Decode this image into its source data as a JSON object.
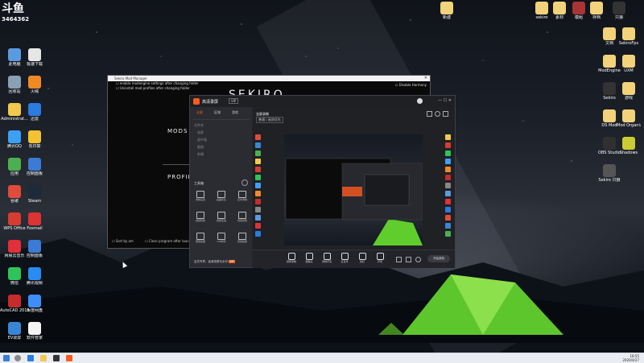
{
  "desktop": {
    "live_badge_number": "3464362",
    "icons_left": [
      {
        "label": "此电脑",
        "color": "#5a9be0"
      },
      {
        "label": "回收站",
        "color": "#8aa0b5"
      },
      {
        "label": "Administrat...",
        "color": "#f2c94c"
      },
      {
        "label": "腾讯QQ",
        "color": "#3da0f5"
      },
      {
        "label": "应用",
        "color": "#4cb050"
      },
      {
        "label": "谷歌",
        "color": "#e04b3c"
      },
      {
        "label": "WPS Office",
        "color": "#d63c2f"
      },
      {
        "label": "网易云音乐",
        "color": "#e0303a"
      },
      {
        "label": "微信",
        "color": "#2ec45a"
      },
      {
        "label": "AutoCAD 2015",
        "color": "#c72b2b"
      },
      {
        "label": "EV录屏",
        "color": "#3a86d6"
      },
      {
        "label": "极速下载",
        "color": "#e6e6e6"
      },
      {
        "label": "火绒",
        "color": "#f08a24"
      },
      {
        "label": "迅雷",
        "color": "#2b7be0"
      },
      {
        "label": "向日葵",
        "color": "#f2c230"
      },
      {
        "label": "控制面板",
        "color": "#3a7bd5"
      },
      {
        "label": "Steam",
        "color": "#1c2a3a"
      },
      {
        "label": "Foxmail",
        "color": "#d33"
      },
      {
        "label": "控制面板",
        "color": "#3a7bd5"
      },
      {
        "label": "腾讯视频",
        "color": "#2a8bf2"
      },
      {
        "label": "百度网盘",
        "color": "#3e8ef7"
      },
      {
        "label": "软件管家",
        "color": "#f4f4f4"
      }
    ],
    "icons_right": [
      {
        "label": "新建",
        "color": "#f2d27a"
      },
      {
        "label": "sekiro",
        "color": "#f2d27a"
      },
      {
        "label": "素材",
        "color": "#f2d27a"
      },
      {
        "label": "模组",
        "color": "#a33"
      },
      {
        "label": "存档",
        "color": "#f2d27a"
      },
      {
        "label": "只狼",
        "color": "#333"
      },
      {
        "label": "文档",
        "color": "#f2d27a"
      },
      {
        "label": "SekiroFps",
        "color": "#f2d27a"
      },
      {
        "label": "ModEngine",
        "color": "#f2d27a"
      },
      {
        "label": "UXM",
        "color": "#f2d27a"
      },
      {
        "label": "Sekiro",
        "color": "#333"
      },
      {
        "label": "游戏",
        "color": "#f2d27a"
      },
      {
        "label": "DS Mod",
        "color": "#f2d27a"
      },
      {
        "label": "Mod Organizer",
        "color": "#f2d27a"
      },
      {
        "label": "OBS Studio",
        "color": "#303030"
      },
      {
        "label": "Shadows",
        "color": "#cc3"
      },
      {
        "label": "Sekiro 只狼",
        "color": "#555"
      }
    ]
  },
  "back_window": {
    "title": "Sekiro Mod Manager",
    "check1": "enable modengine settings after changing folder",
    "check2": "Uninstall mod profiles after changing folder",
    "big_logo": "SEKIRO",
    "menu_mods": "MODS",
    "menu_profiles": "PROFILES",
    "check_bottom1": "Sort by am",
    "check_bottom2": "Close program after launching game",
    "checkbox_right": "Disable Harmony"
  },
  "recorder": {
    "title": "高清录屏",
    "tabs": [
      "全屏",
      "区域",
      "游戏"
    ],
    "sidebar_items": [
      "文件夹",
      "录屏",
      "画中画",
      "截图",
      "剪辑"
    ],
    "tool_section": "工具箱",
    "tools": [
      "录制设置",
      "画面标注",
      "定时录制",
      "视频转换",
      "视频压缩",
      "视频剪辑",
      "屏幕截图",
      "GIF制作",
      "音频提取"
    ],
    "footer": "会员专享，高清录屏无水印",
    "top_label": "全屏录制",
    "mode_a": "普通",
    "mode_b": "画质优先",
    "bottom_buttons": [
      "屏幕录制",
      "摄像头",
      "录制声音",
      "麦克风",
      "鼠标",
      "声音"
    ],
    "record_button": "开始录制",
    "colors": {
      "accent": "#ff5a1f",
      "bg": "#24262b"
    }
  },
  "taskbar": {
    "time": "18:55",
    "date": "2020/4/27"
  }
}
